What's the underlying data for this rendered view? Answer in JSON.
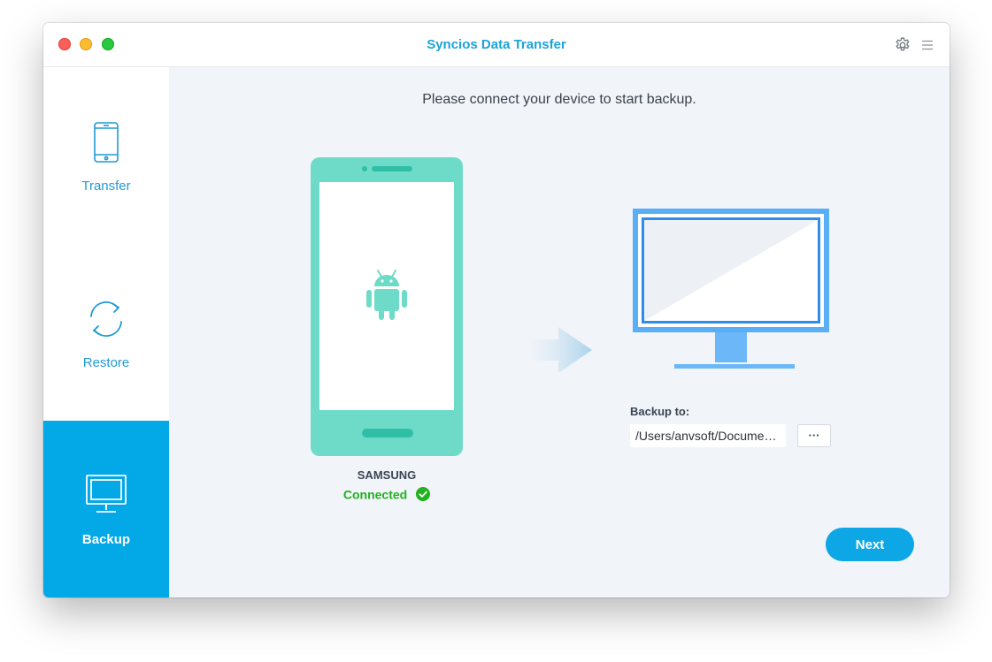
{
  "window": {
    "title": "Syncios Data Transfer"
  },
  "titlebar": {
    "settings_icon": "gear-icon",
    "menu_icon": "hamburger-menu-icon"
  },
  "sidebar": {
    "items": [
      {
        "label": "Transfer",
        "icon": "smartphone-icon",
        "active": false
      },
      {
        "label": "Restore",
        "icon": "refresh-cycle-icon",
        "active": false
      },
      {
        "label": "Backup",
        "icon": "desktop-monitor-icon",
        "active": true
      }
    ]
  },
  "main": {
    "prompt": "Please connect your device to start backup.",
    "device": {
      "name": "SAMSUNG",
      "status": "Connected",
      "icon": "android-icon"
    },
    "backup": {
      "label": "Backup to:",
      "path": "/Users/anvsoft/Documents/Syncios Data Transfer",
      "browse_label": "···"
    },
    "next_label": "Next"
  },
  "colors": {
    "accent": "#03a8e6",
    "title_blue": "#1ba3d9",
    "phone_teal": "#6ddbc8",
    "monitor_blue": "#5aaef5",
    "connected_green": "#22b11f",
    "background": "#f1f4f9"
  }
}
